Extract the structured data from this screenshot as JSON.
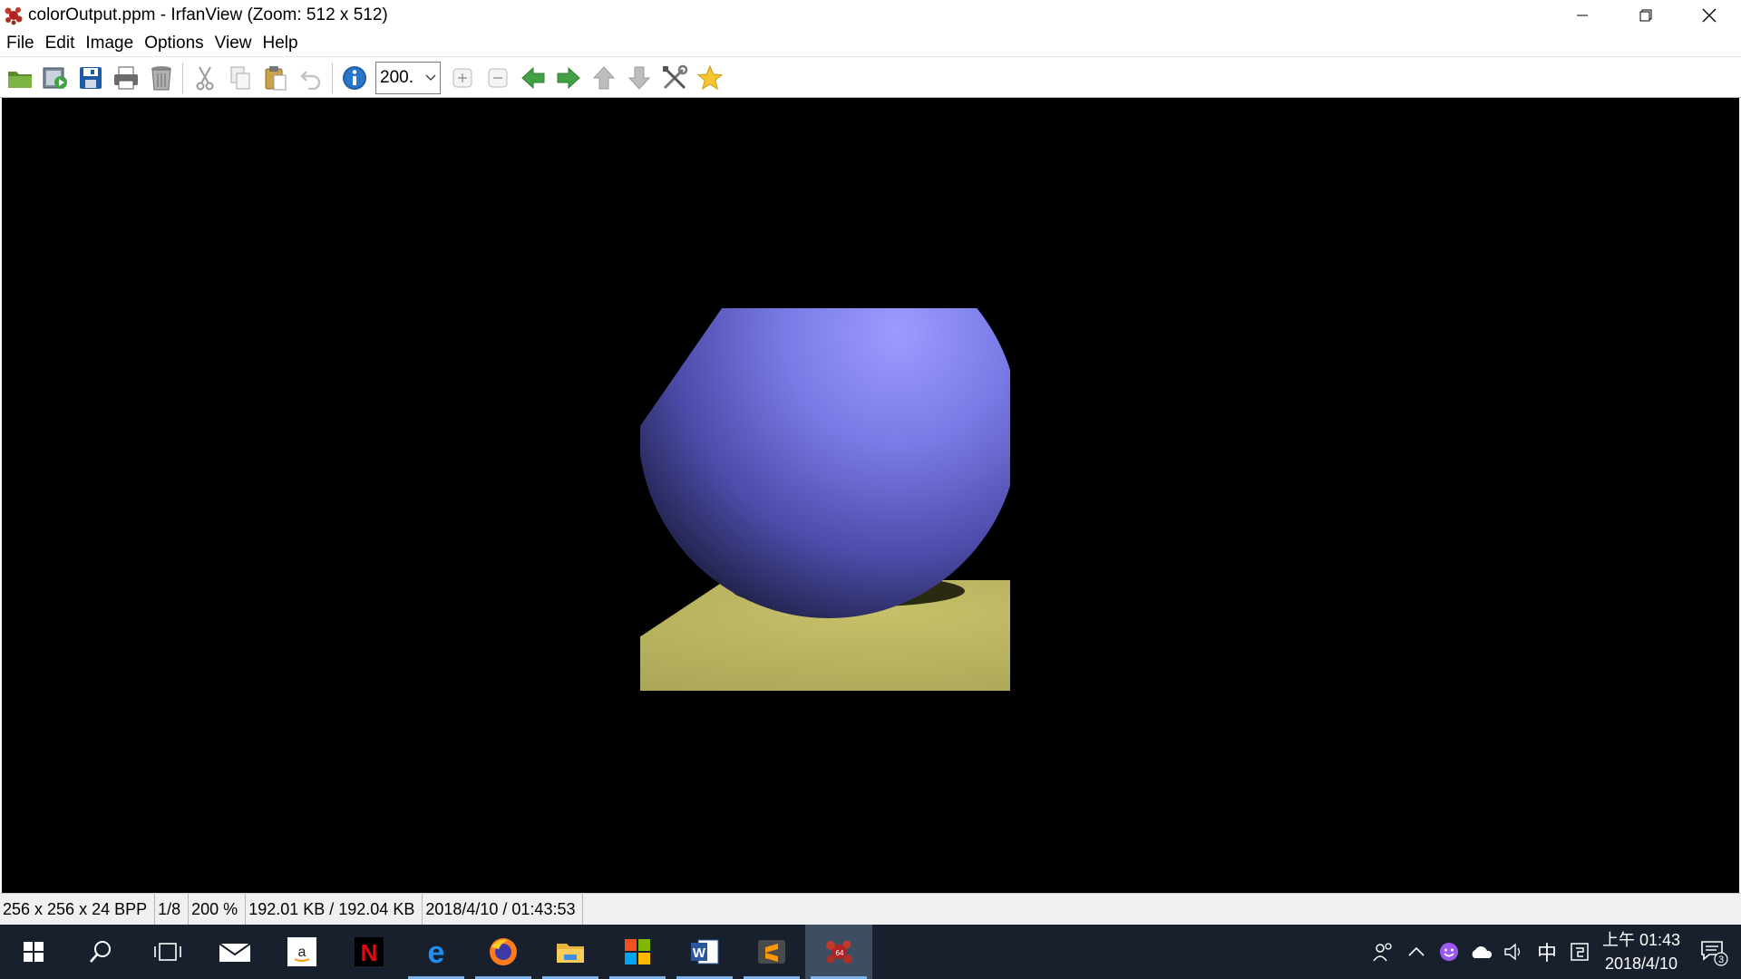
{
  "window": {
    "title": "colorOutput.ppm - IrfanView (Zoom: 512 x 512)"
  },
  "menu": [
    "File",
    "Edit",
    "Image",
    "Options",
    "View",
    "Help"
  ],
  "toolbar": {
    "zoom_value": "200.",
    "buttons": [
      "open-icon",
      "slideshow-icon",
      "save-icon",
      "print-icon",
      "delete-icon",
      "cut-icon",
      "copy-icon",
      "paste-icon",
      "undo-icon",
      "info-icon",
      "zoom-in-icon",
      "zoom-out-icon",
      "previous-icon",
      "next-icon",
      "first-icon",
      "last-icon",
      "settings-icon",
      "favorite-icon"
    ]
  },
  "status": {
    "dimensions": "256 x 256 x 24 BPP",
    "index": "1/8",
    "zoom": "200 %",
    "filesize": "192.01 KB / 192.04 KB",
    "datetime": "2018/4/10 / 01:43:53"
  },
  "taskbar": {
    "apps": [
      "mail",
      "amazon",
      "netflix",
      "edge",
      "firefox",
      "file-explorer",
      "store",
      "word",
      "sublime-text",
      "irfanview"
    ],
    "clock_time": "上午 01:43",
    "clock_date": "2018/4/10",
    "ime": "中",
    "notifications_count": "3"
  },
  "colors": {
    "sphere": "#7a7ae6",
    "plane": "#b8b860",
    "taskbar": "#17202c"
  }
}
